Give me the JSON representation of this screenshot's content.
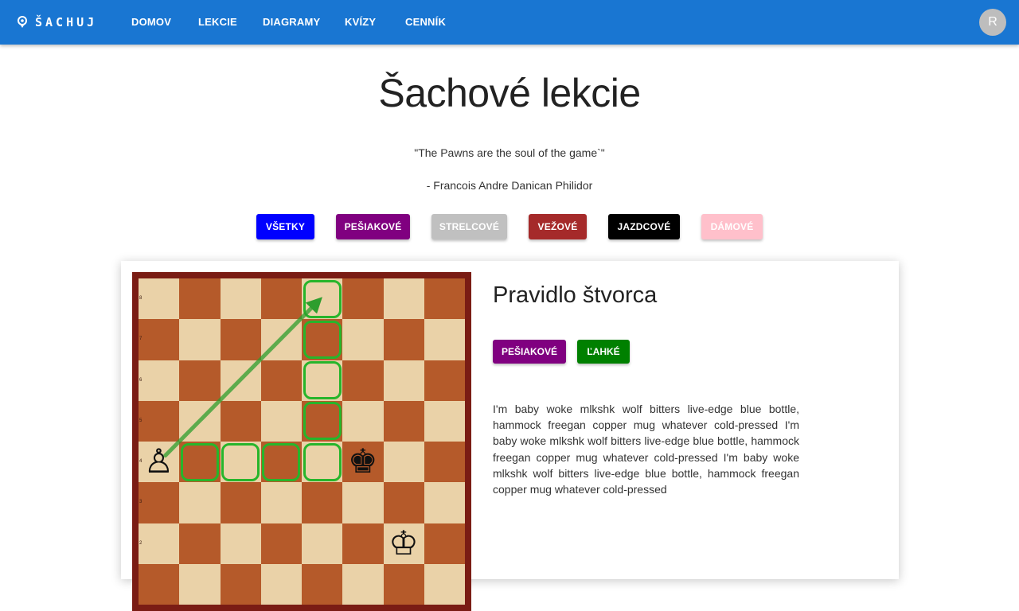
{
  "appbar": {
    "logo_text": "ŠACHUJ",
    "logo_icon": "chess-pawn-icon",
    "nav": [
      "DOMOV",
      "LEKCIE",
      "DIAGRAMY",
      "KVÍZY",
      "CENNÍK"
    ],
    "avatar_initial": "R",
    "color": "#1976d2"
  },
  "header": {
    "title": "Šachové lekcie",
    "quote": "\"The Pawns are the soul of the game`\"",
    "author": "- Francois Andre Danican Philidor"
  },
  "filters": [
    {
      "label": "VŠETKY",
      "color": "#0000ff"
    },
    {
      "label": "PEŠIAKOVÉ",
      "color": "#800080"
    },
    {
      "label": "STRELCOVÉ",
      "color": "#c0c0c0"
    },
    {
      "label": "VEŽOVÉ",
      "color": "#a52a2a"
    },
    {
      "label": "JAZDCOVÉ",
      "color": "#000000"
    },
    {
      "label": "DÁMOVÉ",
      "color": "#ffc0cb"
    }
  ],
  "lesson": {
    "title": "Pravidlo štvorca",
    "tags": [
      {
        "label": "PEŠIAKOVÉ",
        "color": "#800080"
      },
      {
        "label": "ĽAHKÉ",
        "color": "#008000"
      }
    ],
    "description": "I'm baby woke mlkshk wolf bitters live-edge blue bottle, hammock freegan copper mug whatever cold-pressed I'm baby woke mlkshk wolf bitters live-edge blue bottle, hammock freegan copper mug whatever cold-pressed I'm baby woke mlkshk wolf bitters live-edge blue bottle, hammock freegan copper mug whatever cold-pressed",
    "board": {
      "rank_labels": [
        "8",
        "7",
        "6",
        "5",
        "4",
        "3",
        "2"
      ],
      "pieces": [
        {
          "square": "a4",
          "glyph": "♙",
          "name": "white-pawn-icon"
        },
        {
          "square": "f4",
          "glyph": "♚",
          "name": "black-king-icon"
        },
        {
          "square": "g2",
          "glyph": "♔",
          "name": "white-king-icon"
        }
      ],
      "highlighted_squares": [
        "b4",
        "c4",
        "d4",
        "e4",
        "e5",
        "e6",
        "e7",
        "e8"
      ],
      "arrow": {
        "from": "a4",
        "to": "e8",
        "color": "#2e9e2e"
      }
    }
  }
}
